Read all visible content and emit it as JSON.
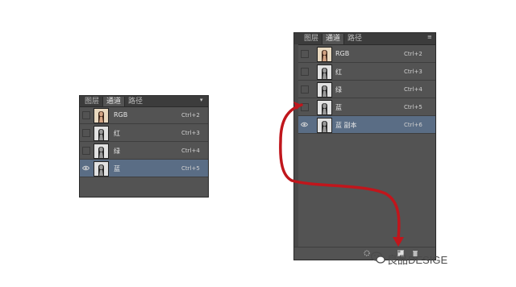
{
  "panel_small": {
    "tabs": [
      {
        "label": "图层",
        "active": false
      },
      {
        "label": "通道",
        "active": true
      },
      {
        "label": "路径",
        "active": false
      }
    ],
    "channels": [
      {
        "name": "RGB",
        "shortcut": "Ctrl+2",
        "visible": false,
        "selected": false,
        "thumb": "color"
      },
      {
        "name": "红",
        "shortcut": "Ctrl+3",
        "visible": false,
        "selected": false,
        "thumb": "gray"
      },
      {
        "name": "绿",
        "shortcut": "Ctrl+4",
        "visible": false,
        "selected": false,
        "thumb": "gray"
      },
      {
        "name": "蓝",
        "shortcut": "Ctrl+5",
        "visible": true,
        "selected": true,
        "thumb": "gray"
      }
    ]
  },
  "panel_large": {
    "tabs": [
      {
        "label": "图层",
        "active": false
      },
      {
        "label": "通道",
        "active": true
      },
      {
        "label": "路径",
        "active": false
      }
    ],
    "channels": [
      {
        "name": "RGB",
        "shortcut": "Ctrl+2",
        "visible": false,
        "selected": false,
        "thumb": "color"
      },
      {
        "name": "红",
        "shortcut": "Ctrl+3",
        "visible": false,
        "selected": false,
        "thumb": "gray"
      },
      {
        "name": "绿",
        "shortcut": "Ctrl+4",
        "visible": false,
        "selected": false,
        "thumb": "gray"
      },
      {
        "name": "蓝",
        "shortcut": "Ctrl+5",
        "visible": false,
        "selected": false,
        "thumb": "gray"
      },
      {
        "name": "蓝 副本",
        "shortcut": "Ctrl+6",
        "visible": true,
        "selected": true,
        "thumb": "gray"
      }
    ],
    "footer_icons": [
      "load-selection-icon",
      "new-channel-icon",
      "delete-channel-icon"
    ]
  },
  "annotation": {
    "color": "#c0161c"
  },
  "watermark": {
    "text": "良品DESIGE"
  },
  "colors": {
    "panel_bg": "#535353",
    "tabbar_bg": "#3c3c3c",
    "selected_row": "#5a6d85",
    "arrow": "#c0161c"
  }
}
